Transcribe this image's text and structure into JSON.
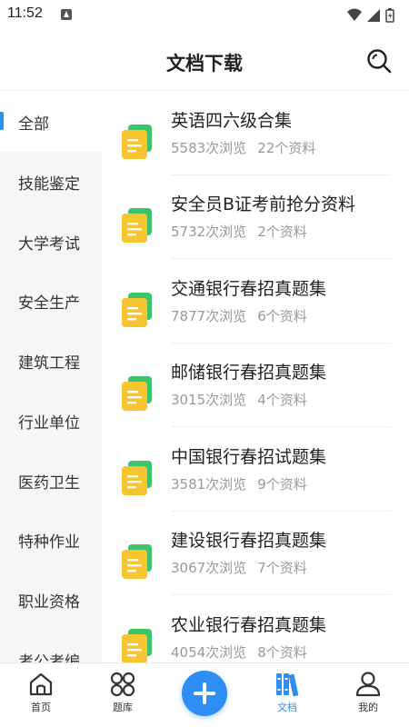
{
  "status_bar": {
    "time": "11:52",
    "icons": [
      "app-notification-icon",
      "wifi-icon",
      "signal-icon",
      "battery-icon"
    ]
  },
  "header": {
    "title": "文档下载",
    "search_icon": "search-icon"
  },
  "sidebar": {
    "items": [
      {
        "label": "全部",
        "active": true
      },
      {
        "label": "技能鉴定"
      },
      {
        "label": "大学考试"
      },
      {
        "label": "安全生产"
      },
      {
        "label": "建筑工程"
      },
      {
        "label": "行业单位"
      },
      {
        "label": "医药卫生"
      },
      {
        "label": "特种作业"
      },
      {
        "label": "职业资格"
      },
      {
        "label": "考公考编"
      }
    ]
  },
  "documents": [
    {
      "title": "英语四六级合集",
      "views": "5583次浏览",
      "count": "22个资料"
    },
    {
      "title": "安全员B证考前抢分资料",
      "views": "5732次浏览",
      "count": "2个资料"
    },
    {
      "title": "交通银行春招真题集",
      "views": "7877次浏览",
      "count": "6个资料"
    },
    {
      "title": "邮储银行春招真题集",
      "views": "3015次浏览",
      "count": "4个资料"
    },
    {
      "title": "中国银行春招试题集",
      "views": "3581次浏览",
      "count": "9个资料"
    },
    {
      "title": "建设银行春招真题集",
      "views": "3067次浏览",
      "count": "7个资料"
    },
    {
      "title": "农业银行春招真题集",
      "views": "4054次浏览",
      "count": "8个资料"
    }
  ],
  "tabbar": {
    "items": [
      {
        "label": "首页",
        "icon": "home-icon"
      },
      {
        "label": "题库",
        "icon": "grid-icon"
      },
      {
        "label": "",
        "icon": "plus-icon"
      },
      {
        "label": "文档",
        "icon": "books-icon",
        "active": true
      },
      {
        "label": "我的",
        "icon": "person-icon"
      }
    ]
  },
  "colors": {
    "accent": "#2f8df6",
    "sidebar_bg": "#f5f6f8",
    "doc_icon_yellow": "#f6c531",
    "doc_icon_green": "#3cc46b",
    "meta_text": "#999999"
  }
}
